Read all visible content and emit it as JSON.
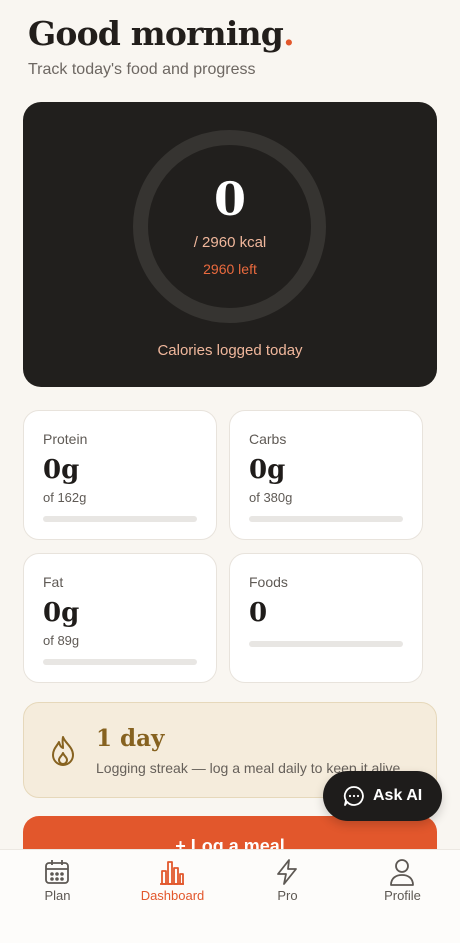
{
  "header": {
    "greeting": "Good morning",
    "greeting_dot": ".",
    "subtitle": "Track today's food and progress"
  },
  "calories": {
    "logged": "0",
    "goal_text": "/ 2960 kcal",
    "left_text": "2960 left",
    "caption": "Calories logged today",
    "progress": 0
  },
  "macros": [
    {
      "label": "Protein",
      "value": "0g",
      "goal": "of 162g",
      "progress": 0
    },
    {
      "label": "Carbs",
      "value": "0g",
      "goal": "of 380g",
      "progress": 0
    },
    {
      "label": "Fat",
      "value": "0g",
      "goal": "of 89g",
      "progress": 0
    },
    {
      "label": "Foods",
      "value": "0",
      "progress": 0
    }
  ],
  "streak": {
    "title": "1 day",
    "text": "Logging streak — log a meal daily to keep it alive",
    "icon": "flame-icon"
  },
  "actions": {
    "log_meal": "+ Log a meal",
    "ask_ai": "Ask AI",
    "ask_ai_icon": "chat-bubble-icon"
  },
  "tabbar": {
    "active": "Dashboard",
    "items": [
      {
        "label": "Plan",
        "icon": "calendar-icon"
      },
      {
        "label": "Dashboard",
        "icon": "bar-chart-icon"
      },
      {
        "label": "Pro",
        "icon": "lightning-icon"
      },
      {
        "label": "Profile",
        "icon": "user-icon"
      }
    ]
  },
  "colors": {
    "accent": "#e2572c",
    "background": "#f9f6f1",
    "hero": "#211f1d",
    "streak_title": "#866220"
  }
}
